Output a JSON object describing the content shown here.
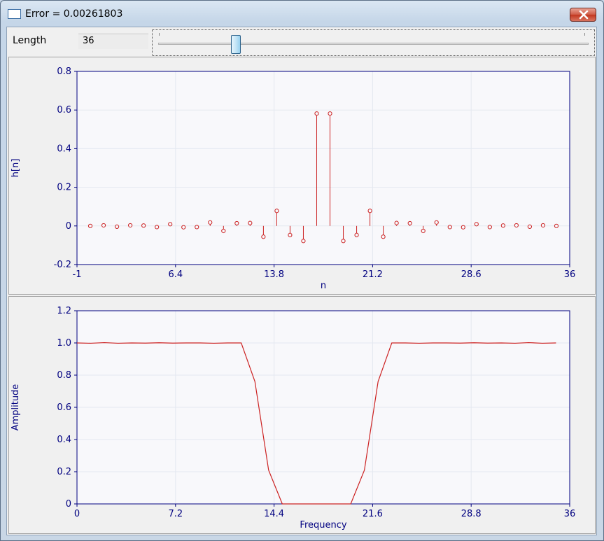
{
  "window": {
    "title": "Error = 0.00261803",
    "close_icon": "close-icon"
  },
  "controls": {
    "length_label": "Length",
    "length_value": "36",
    "slider_min": 0,
    "slider_max": 200,
    "slider_value": 36
  },
  "colors": {
    "axis": "#000080",
    "series": "#cc2222",
    "grid": "#e4e8f0"
  },
  "chart_data": [
    {
      "type": "stem",
      "xlabel": "n",
      "ylabel": "h[n]",
      "xlim": [
        -1,
        36
      ],
      "ylim": [
        -0.2,
        0.8
      ],
      "xticks": [
        "-1",
        "6.4",
        "13.8",
        "21.2",
        "28.6",
        "36"
      ],
      "yticks": [
        "-0.2",
        "0",
        "0.2",
        "0.4",
        "0.6",
        "0.8"
      ],
      "grid": true,
      "x": [
        0,
        1,
        2,
        3,
        4,
        5,
        6,
        7,
        8,
        9,
        10,
        11,
        12,
        13,
        14,
        15,
        16,
        17,
        18,
        19,
        20,
        21,
        22,
        23,
        24,
        25,
        26,
        27,
        28,
        29,
        30,
        31,
        32,
        33,
        34,
        35
      ],
      "values": [
        0.0,
        0.003,
        -0.004,
        0.003,
        0.002,
        -0.006,
        0.009,
        -0.007,
        -0.006,
        0.018,
        -0.026,
        0.014,
        0.015,
        -0.056,
        0.078,
        -0.047,
        -0.078,
        0.582,
        0.582,
        -0.078,
        -0.047,
        0.078,
        -0.056,
        0.015,
        0.014,
        -0.026,
        0.018,
        -0.006,
        -0.007,
        0.009,
        -0.006,
        0.002,
        0.003,
        -0.004,
        0.003,
        0.0
      ]
    },
    {
      "type": "line",
      "xlabel": "Frequency",
      "ylabel": "Amplitude",
      "xlim": [
        0,
        36
      ],
      "ylim": [
        0,
        1.2
      ],
      "xticks": [
        "0",
        "7.2",
        "14.4",
        "21.6",
        "28.8",
        "36"
      ],
      "yticks": [
        "0",
        "0.2",
        "0.4",
        "0.6",
        "0.8",
        "1.0",
        "1.2"
      ],
      "grid": true,
      "x": [
        0,
        1,
        2,
        3,
        4,
        5,
        6,
        7,
        8,
        9,
        10,
        11,
        12,
        13,
        14,
        15,
        16,
        17,
        18,
        19,
        20,
        21,
        22,
        23,
        24,
        25,
        26,
        27,
        28,
        29,
        30,
        31,
        32,
        33,
        34,
        35
      ],
      "values": [
        1.0,
        0.998,
        1.002,
        0.998,
        1.0,
        0.999,
        1.001,
        0.999,
        1.0,
        1.0,
        0.998,
        1.0,
        1.0,
        0.76,
        0.21,
        0.0,
        0.0,
        0.0,
        0.0,
        0.0,
        0.0,
        0.21,
        0.76,
        1.0,
        1.0,
        0.998,
        1.0,
        1.0,
        0.999,
        1.001,
        0.999,
        1.0,
        0.998,
        1.002,
        0.998,
        1.0
      ]
    }
  ]
}
